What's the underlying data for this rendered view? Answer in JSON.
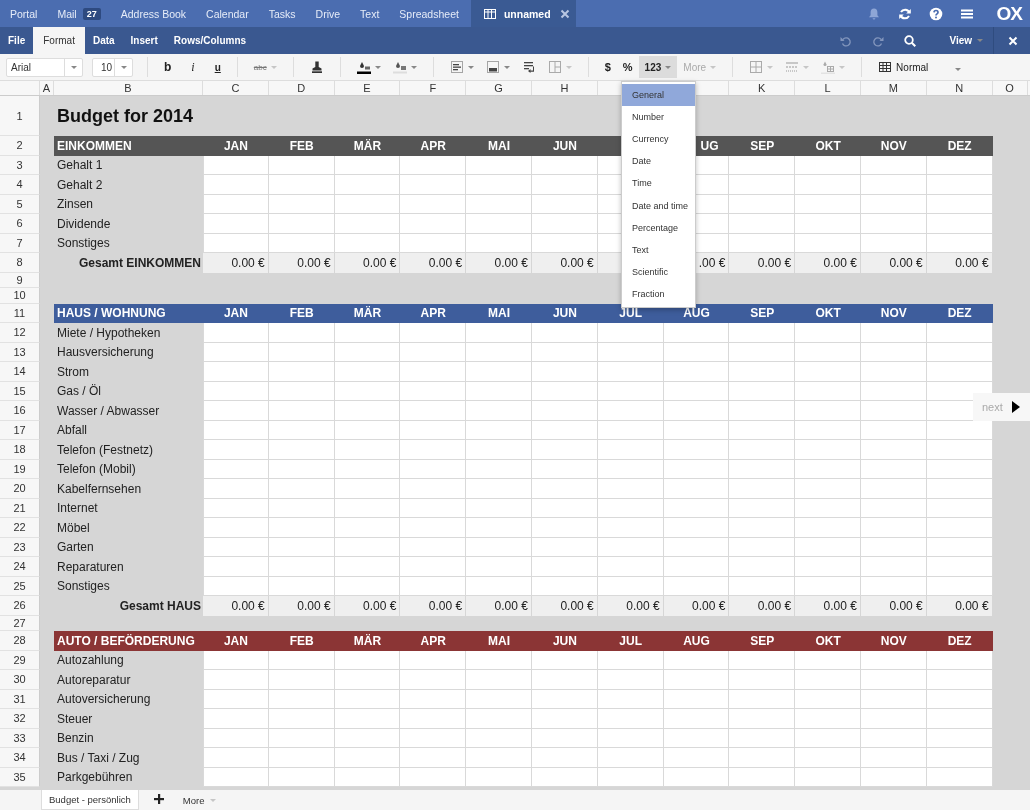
{
  "app_tabs": [
    {
      "label": "Portal",
      "selected": false
    },
    {
      "label": "Mail",
      "badge": "27",
      "selected": false
    },
    {
      "label": "Address Book",
      "selected": false
    },
    {
      "label": "Calendar",
      "selected": false
    },
    {
      "label": "Tasks",
      "selected": false
    },
    {
      "label": "Drive",
      "selected": false
    },
    {
      "label": "Text",
      "selected": false
    },
    {
      "label": "Spreadsheet",
      "selected": false
    }
  ],
  "document_tab": {
    "label": "unnamed",
    "selected": true
  },
  "logo": "OX",
  "menu_bar": {
    "items": [
      {
        "label": "File",
        "selected": false
      },
      {
        "label": "Format",
        "selected": true
      },
      {
        "label": "Data",
        "selected": false
      },
      {
        "label": "Insert",
        "selected": false
      },
      {
        "label": "Rows/Columns",
        "selected": false
      }
    ],
    "view": "View"
  },
  "toolbar": {
    "font": "Arial",
    "size": "10",
    "bold": "b",
    "italic": "i",
    "underline": "u",
    "strike": "abc",
    "currency": "$",
    "percent": "%",
    "number_format": {
      "label": "123",
      "selected": true
    },
    "more": {
      "label": "More",
      "disabled": true
    },
    "cell_style": "Normal"
  },
  "columns_left": [
    "A",
    "B",
    "C",
    "D",
    "E",
    "F",
    "G",
    "H"
  ],
  "columns_right": [
    "K",
    "L",
    "M",
    "N",
    "O"
  ],
  "rows": [
    {
      "num": "1",
      "kind": "title",
      "text": "Budget for 2014"
    },
    {
      "num": "2",
      "kind": "header",
      "color": "#555555",
      "title": "EINKOMMEN",
      "months_left": [
        "JAN",
        "FEB",
        "MÄR",
        "APR",
        "MAI",
        "JUN"
      ],
      "months_right": [
        "UG",
        "SEP",
        "OKT",
        "NOV",
        "DEZ"
      ]
    },
    {
      "num": "3",
      "kind": "item",
      "label": "Gehalt 1"
    },
    {
      "num": "4",
      "kind": "item",
      "label": "Gehalt 2"
    },
    {
      "num": "5",
      "kind": "item",
      "label": "Zinsen"
    },
    {
      "num": "6",
      "kind": "item",
      "label": "Dividende"
    },
    {
      "num": "7",
      "kind": "item",
      "label": "Sonstiges"
    },
    {
      "num": "8",
      "kind": "total",
      "label": "Gesamt EINKOMMEN",
      "values_left": [
        "0.00 €",
        "0.00 €",
        "0.00 €",
        "0.00 €",
        "0.00 €",
        "0.00 €"
      ],
      "values_right": [
        ".00 €",
        "0.00 €",
        "0.00 €",
        "0.00 €",
        "0.00 €"
      ]
    },
    {
      "num": "9",
      "kind": "blank"
    },
    {
      "num": "10",
      "kind": "blank"
    },
    {
      "num": "11",
      "kind": "header",
      "color": "#3e5d9c",
      "title": "HAUS / WOHNUNG",
      "months": [
        "JAN",
        "FEB",
        "MÄR",
        "APR",
        "MAI",
        "JUN",
        "JUL",
        "AUG",
        "SEP",
        "OKT",
        "NOV",
        "DEZ"
      ]
    },
    {
      "num": "12",
      "kind": "item",
      "label": "Miete / Hypotheken"
    },
    {
      "num": "13",
      "kind": "item",
      "label": "Hausversicherung"
    },
    {
      "num": "14",
      "kind": "item",
      "label": "Strom"
    },
    {
      "num": "15",
      "kind": "item",
      "label": "Gas / Öl"
    },
    {
      "num": "16",
      "kind": "item",
      "label": "Wasser / Abwasser"
    },
    {
      "num": "17",
      "kind": "item",
      "label": "Abfall"
    },
    {
      "num": "18",
      "kind": "item",
      "label": "Telefon (Festnetz)"
    },
    {
      "num": "19",
      "kind": "item",
      "label": "Telefon (Mobil)"
    },
    {
      "num": "20",
      "kind": "item",
      "label": "Kabelfernsehen"
    },
    {
      "num": "21",
      "kind": "item",
      "label": "Internet"
    },
    {
      "num": "22",
      "kind": "item",
      "label": "Möbel"
    },
    {
      "num": "23",
      "kind": "item",
      "label": "Garten"
    },
    {
      "num": "24",
      "kind": "item",
      "label": "Reparaturen"
    },
    {
      "num": "25",
      "kind": "item",
      "label": "Sonstiges"
    },
    {
      "num": "26",
      "kind": "total",
      "label": "Gesamt HAUS",
      "values": [
        "0.00 €",
        "0.00 €",
        "0.00 €",
        "0.00 €",
        "0.00 €",
        "0.00 €",
        "0.00 €",
        "0.00 €",
        "0.00 €",
        "0.00 €",
        "0.00 €",
        "0.00 €"
      ]
    },
    {
      "num": "27",
      "kind": "blank"
    },
    {
      "num": "28",
      "kind": "header",
      "color": "#8b3535",
      "title": "AUTO / BEFÖRDERUNG",
      "months": [
        "JAN",
        "FEB",
        "MÄR",
        "APR",
        "MAI",
        "JUN",
        "JUL",
        "AUG",
        "SEP",
        "OKT",
        "NOV",
        "DEZ"
      ]
    },
    {
      "num": "29",
      "kind": "item",
      "label": "Autozahlung"
    },
    {
      "num": "30",
      "kind": "item",
      "label": "Autoreparatur"
    },
    {
      "num": "31",
      "kind": "item",
      "label": "Autoversicherung"
    },
    {
      "num": "32",
      "kind": "item",
      "label": "Steuer"
    },
    {
      "num": "33",
      "kind": "item",
      "label": "Benzin"
    },
    {
      "num": "34",
      "kind": "item",
      "label": "Bus / Taxi / Zug"
    },
    {
      "num": "35",
      "kind": "item",
      "label": "Parkgebühren"
    }
  ],
  "format_menu": {
    "items": [
      {
        "label": "General",
        "selected": true
      },
      {
        "label": "Number",
        "selected": false
      },
      {
        "label": "Currency",
        "selected": false
      },
      {
        "label": "Date",
        "selected": false
      },
      {
        "label": "Time",
        "selected": false
      },
      {
        "label": "Date and time",
        "selected": false
      },
      {
        "label": "Percentage",
        "selected": false
      },
      {
        "label": "Text",
        "selected": false
      },
      {
        "label": "Scientific",
        "selected": false
      },
      {
        "label": "Fraction",
        "selected": false
      }
    ]
  },
  "next_button": "next",
  "sheet_tabs": [
    {
      "label": "Budget - persönlich",
      "selected": true
    }
  ],
  "more_sheets": "More"
}
